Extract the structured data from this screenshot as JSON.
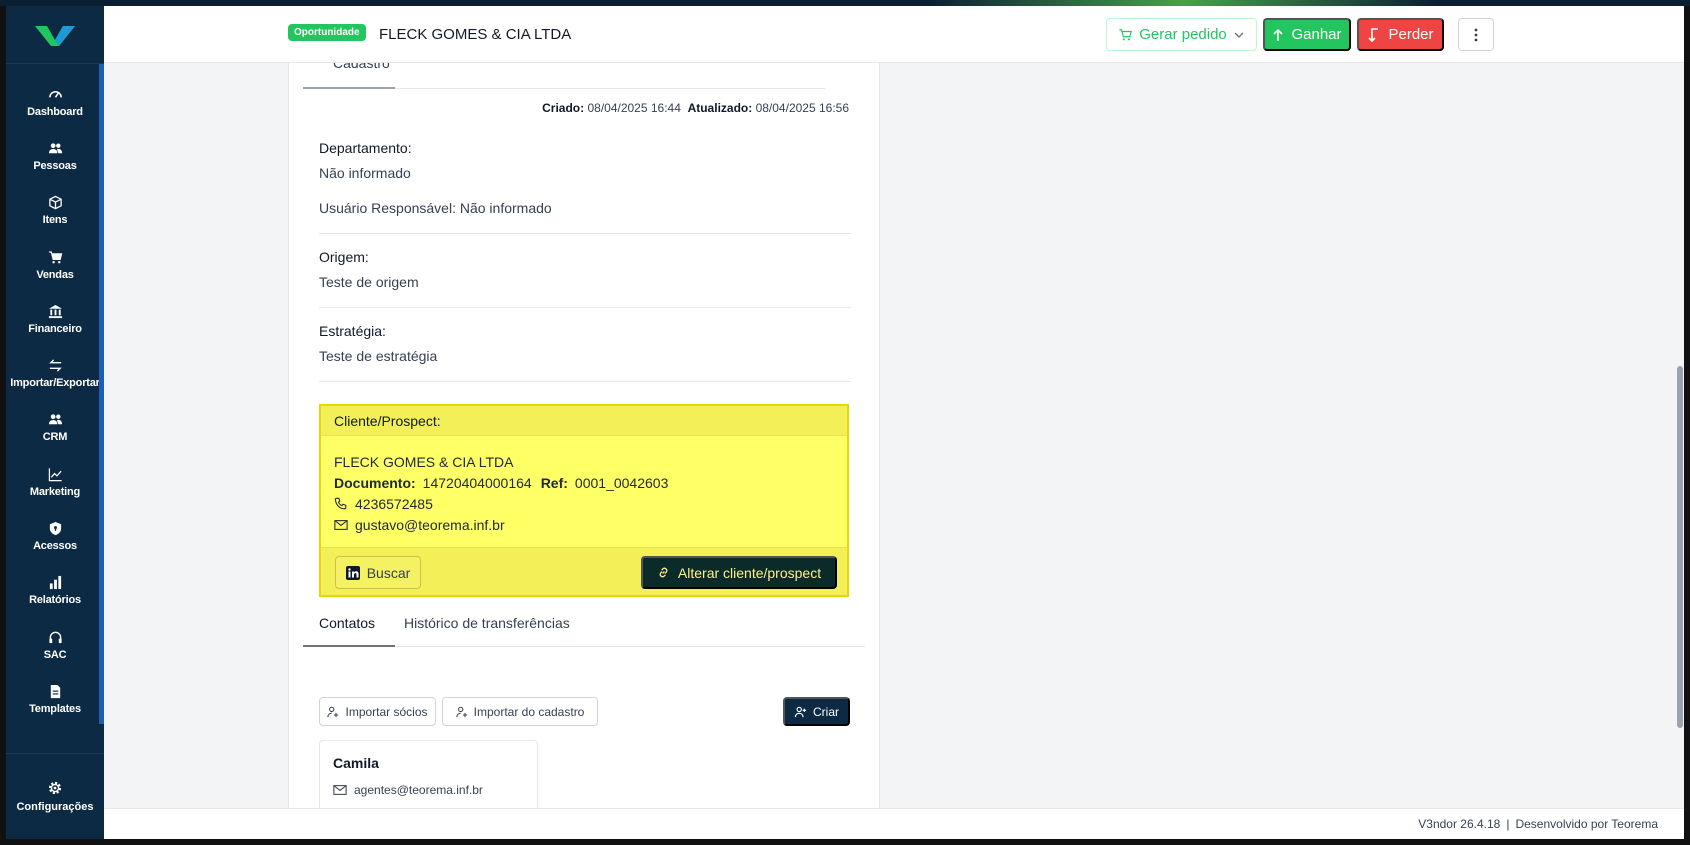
{
  "sidebar": {
    "items": [
      {
        "label": "Dashboard",
        "icon": "gauge-icon"
      },
      {
        "label": "Pessoas",
        "icon": "people-icon"
      },
      {
        "label": "Itens",
        "icon": "box-icon"
      },
      {
        "label": "Vendas",
        "icon": "cart-icon"
      },
      {
        "label": "Financeiro",
        "icon": "bank-icon"
      },
      {
        "label": "Importar/Exportar",
        "icon": "arrows-icon"
      },
      {
        "label": "CRM",
        "icon": "people-icon"
      },
      {
        "label": "Marketing",
        "icon": "chart-line-icon"
      },
      {
        "label": "Acessos",
        "icon": "shield-icon"
      },
      {
        "label": "Relatórios",
        "icon": "bar-chart-icon"
      },
      {
        "label": "SAC",
        "icon": "headset-icon"
      },
      {
        "label": "Templates",
        "icon": "file-icon"
      }
    ],
    "settings_label": "Configurações"
  },
  "header": {
    "badge": "Oportunidade",
    "title": "FLECK GOMES & CIA LTDA",
    "gerar_label": "Gerar pedido",
    "ganhar_label": "Ganhar",
    "perder_label": "Perder"
  },
  "cadastro": {
    "tab_label": "Cadastro",
    "created_label": "Criado:",
    "created_value": "08/04/2025 16:44",
    "updated_label": "Atualizado:",
    "updated_value": "08/04/2025 16:56",
    "departamento_label": "Departamento:",
    "departamento_value": "Não informado",
    "usuario_text": "Usuário Responsável: Não informado",
    "origem_label": "Origem:",
    "origem_value": "Teste de origem",
    "estrategia_label": "Estratégia:",
    "estrategia_value": "Teste de estratégia"
  },
  "prospect": {
    "header": "Cliente/Prospect:",
    "name": "FLECK GOMES & CIA LTDA",
    "documento_label": "Documento:",
    "documento_value": "14720404000164",
    "ref_label": "Ref:",
    "ref_value": "0001_0042603",
    "phone": "4236572485",
    "email": "gustavo@teorema.inf.br",
    "buscar_label": "Buscar",
    "alterar_label": "Alterar cliente/prospect"
  },
  "contatos": {
    "tab_contatos": "Contatos",
    "tab_historico": "Histórico de transferências",
    "importar_socios": "Importar sócios",
    "importar_cadastro": "Importar do cadastro",
    "criar": "Criar",
    "contact_name": "Camila",
    "contact_email": "agentes@teorema.inf.br"
  },
  "footer": {
    "version": "V3ndor  26.4.18",
    "separator": "|",
    "developer": "Desenvolvido por Teorema"
  },
  "colors": {
    "sidebar": "#0d2a44",
    "success": "#22c55e",
    "danger": "#ef4444",
    "highlight": "#ffff66"
  }
}
